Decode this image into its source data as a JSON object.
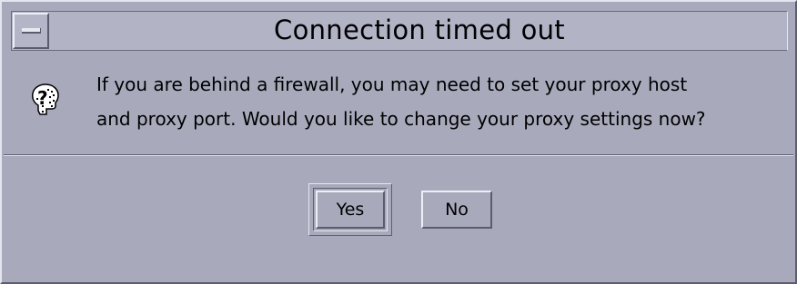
{
  "window": {
    "title": "Connection timed out"
  },
  "dialog": {
    "icon": "question-icon",
    "message_lines": [
      "If you are behind a firewall, you may need to set your proxy host",
      "and proxy port.  Would you like to change your proxy settings now?"
    ]
  },
  "buttons": {
    "yes_label": "Yes",
    "no_label": "No"
  },
  "colors": {
    "background": "#a8aabc",
    "text": "#000000"
  }
}
